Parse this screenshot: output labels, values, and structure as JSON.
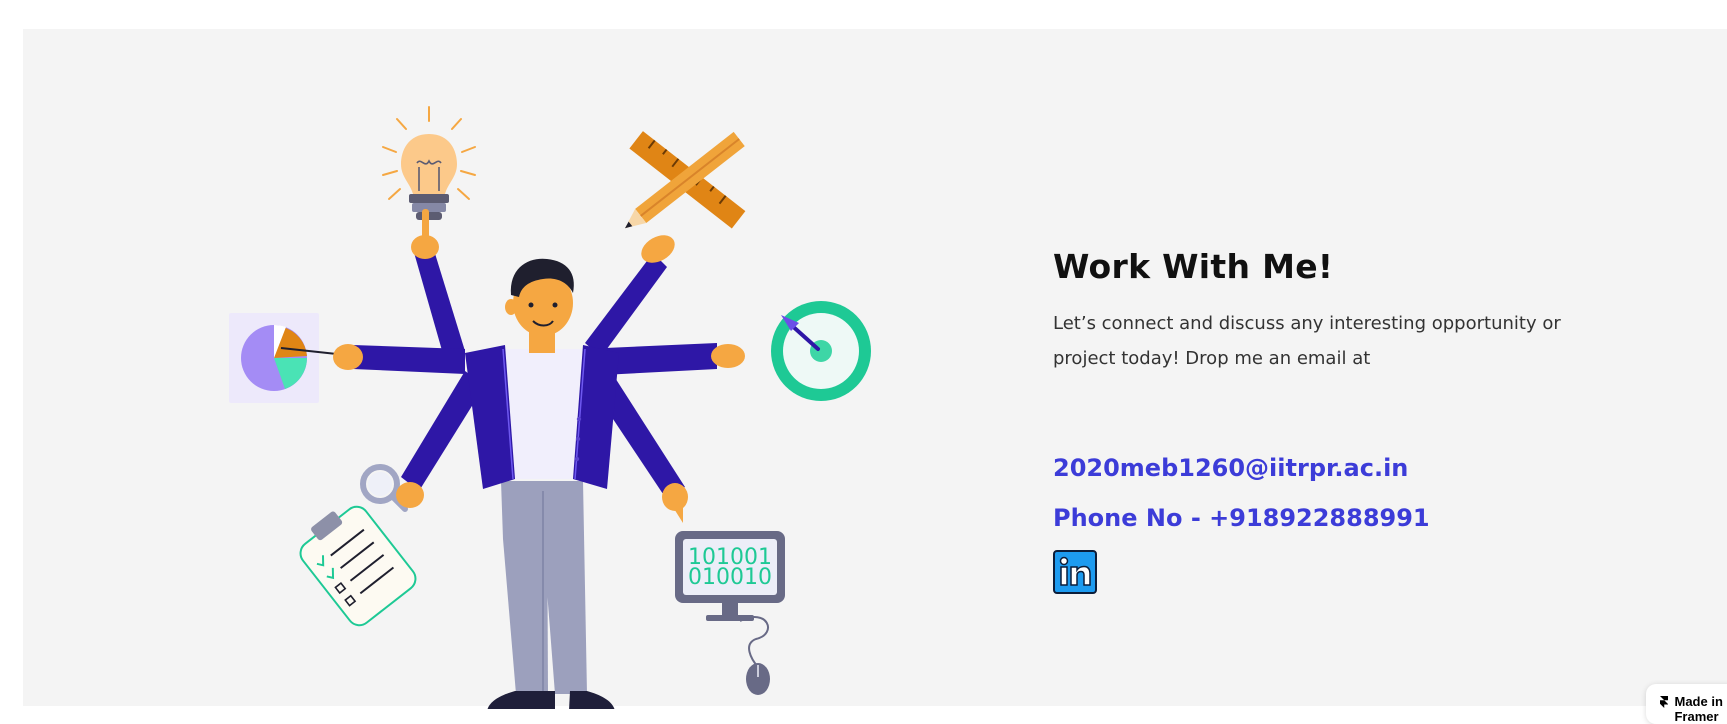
{
  "contact": {
    "heading": "Work With Me!",
    "description": "Let’s connect and discuss any interesting opportunity or project today! Drop me an email at",
    "email": "2020meb1260@iitrpr.ac.in",
    "phone": "Phone No - +918922888991",
    "linkedin_icon": "linkedin-icon"
  },
  "badge": {
    "label": "Made in Framer",
    "icon": "framer-logo-icon"
  },
  "illustration": {
    "binary_line_1": "101001",
    "binary_line_2": "010010"
  },
  "colors": {
    "accent": "#3c3cd8",
    "section_bg": "#f4f4f4",
    "jacket": "#2e17a6",
    "teal": "#1ec995",
    "orange": "#f5a742",
    "linkedin": "#1d9bf0"
  }
}
